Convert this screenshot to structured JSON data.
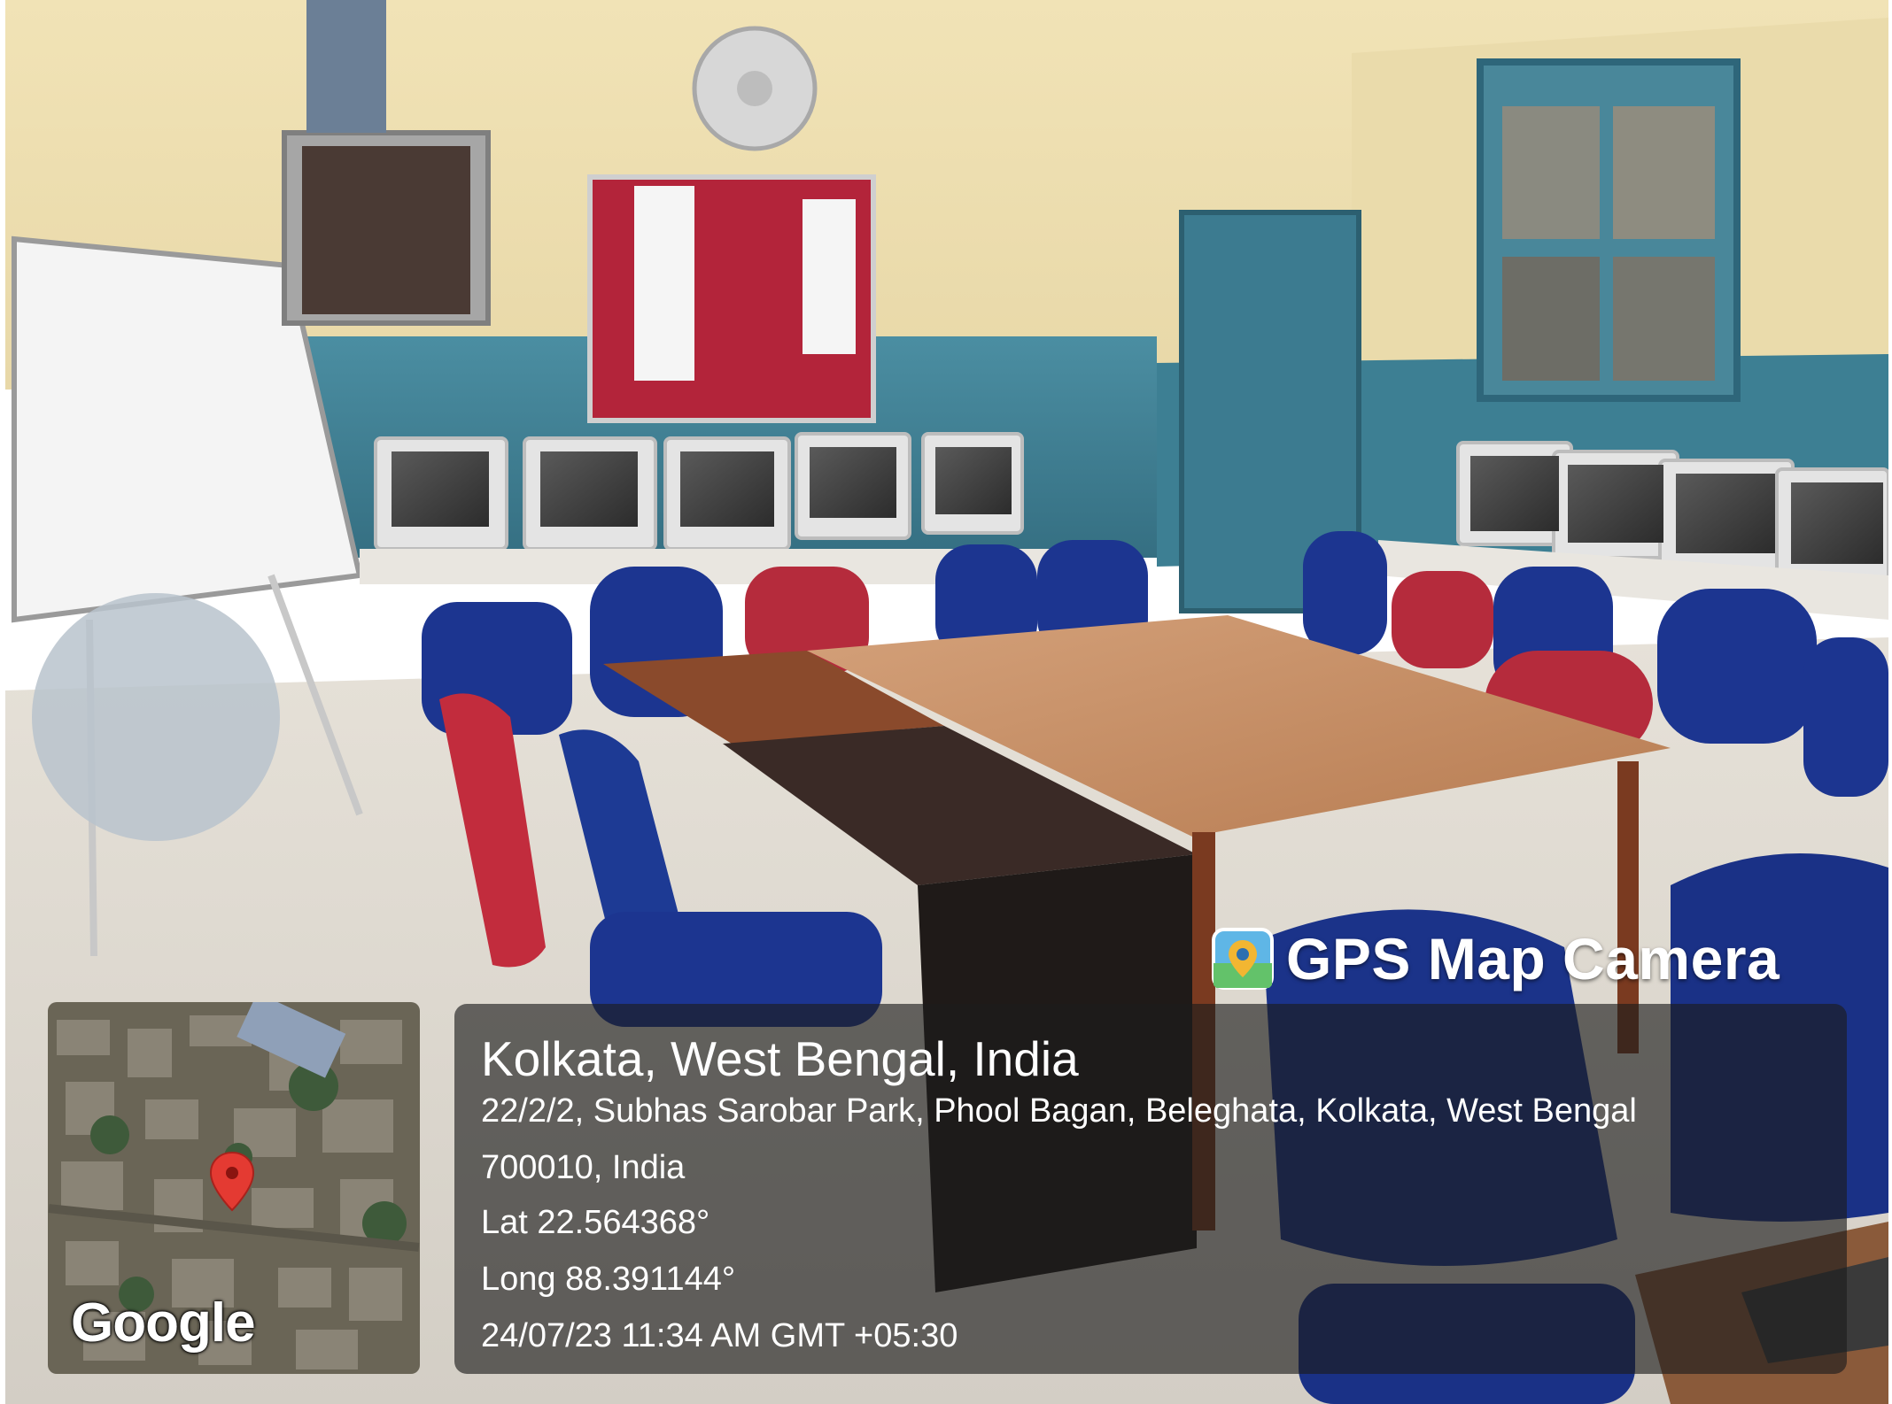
{
  "app": {
    "badge_label": "GPS Map Camera",
    "badge_icon": "map-pin-camera-icon"
  },
  "map": {
    "provider_label": "Google",
    "marker_icon": "location-pin-icon"
  },
  "location": {
    "title": "Kolkata, West Bengal, India",
    "address_line1": "22/2/2, Subhas Sarobar Park, Phool Bagan, Beleghata, Kolkata, West Bengal",
    "address_line2": "700010, India",
    "latitude": "Lat 22.564368°",
    "longitude": "Long 88.391144°",
    "datetime": "24/07/23 11:34 AM GMT +05:30"
  },
  "colors": {
    "wall_upper": "#efe0b0",
    "wall_lower": "#3f8093",
    "door": "#3c7b90",
    "notice_board": "#b3243a",
    "table_top": "#c99065",
    "chair_blue": "#1c3590",
    "chair_red": "#b52b3c",
    "panel_bg": "#1c1c1c",
    "marker": "#e43a32"
  }
}
